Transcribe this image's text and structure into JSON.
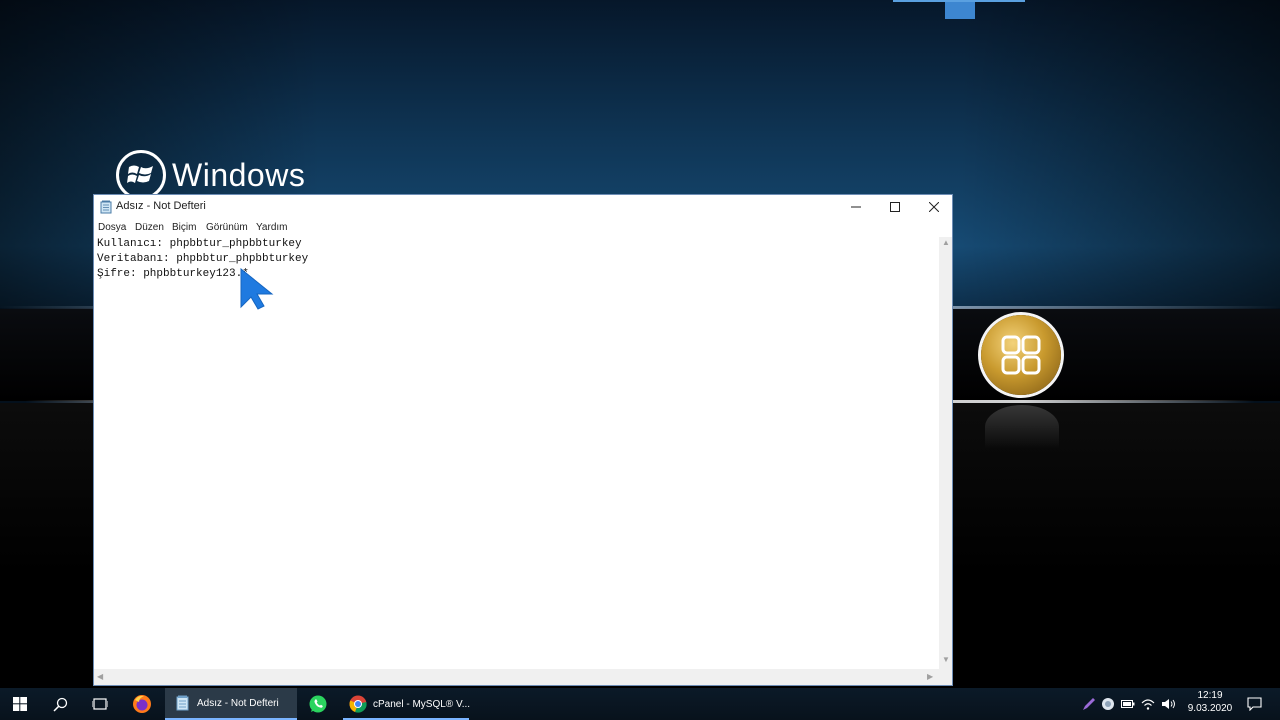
{
  "desktop": {
    "logo_text": "Windows"
  },
  "notepad": {
    "title": "Adsız - Not Defteri",
    "menu": [
      "Dosya",
      "Düzen",
      "Biçim",
      "Görünüm",
      "Yardım"
    ],
    "lines": [
      "Kullanıcı: phpbbtur_phpbbturkey",
      "Veritabanı: phpbbtur_phpbbturkey",
      "Şifre: phpbbturkey123.*"
    ]
  },
  "taskbar": {
    "apps": [
      {
        "icon": "notepad-icon",
        "label": "Adsız - Not Defteri",
        "active": true
      },
      {
        "icon": "whatsapp-icon",
        "label": ""
      },
      {
        "icon": "chrome-icon",
        "label": "cPanel - MySQL® V..."
      }
    ],
    "clock": {
      "time": "12:19",
      "date": "9.03.2020"
    }
  },
  "colors": {
    "accent": "#3d86d0",
    "taskbar": "#0b1a28",
    "titlebar": "#ffffff"
  }
}
